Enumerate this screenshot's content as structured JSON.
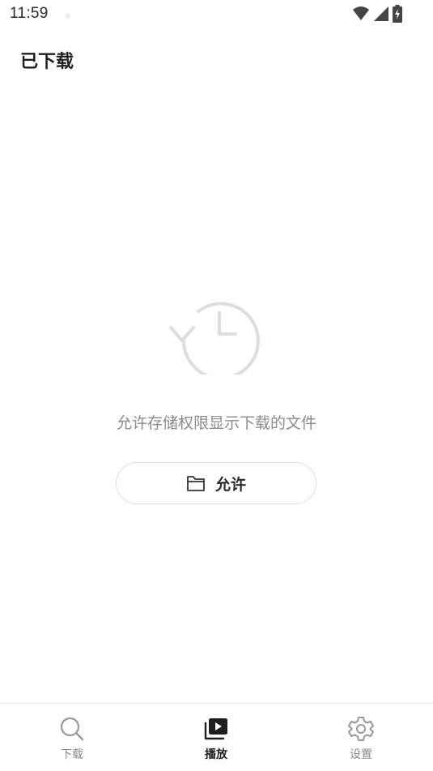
{
  "status_bar": {
    "time": "11:59",
    "icons": [
      "wifi-icon",
      "signal-icon",
      "battery-charging-icon"
    ]
  },
  "page": {
    "title": "已下载"
  },
  "empty_state": {
    "icon": "history-clock-icon",
    "message": "允许存储权限显示下载的文件",
    "button_label": "允许",
    "button_icon": "folder-icon"
  },
  "bottom_nav": {
    "items": [
      {
        "label": "下载",
        "icon": "search-icon",
        "active": false
      },
      {
        "label": "播放",
        "icon": "play-library-icon",
        "active": true
      },
      {
        "label": "设置",
        "icon": "gear-icon",
        "active": false
      }
    ]
  },
  "colors": {
    "background": "#ffffff",
    "title_text": "#1e1e1e",
    "muted_text": "#8a8a8a",
    "icon_muted": "#dddddd",
    "button_border": "#dcdcdc"
  }
}
